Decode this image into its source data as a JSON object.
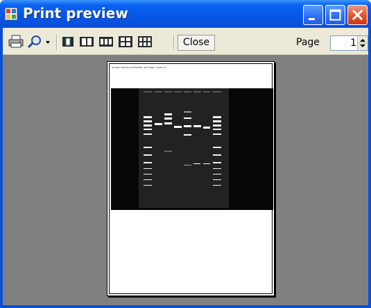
{
  "window": {
    "title": "Print preview",
    "title_color": "#ffffff",
    "frame_color": "#0a4fd6",
    "close_button_color": "#e1542c"
  },
  "toolbar": {
    "print_icon": "printer-icon",
    "zoom_icon": "magnifier-icon",
    "zoom_dropdown_icon": "chevron-down-icon",
    "layout_icons": [
      "one-page-icon",
      "two-pages-icon",
      "three-pages-icon",
      "four-pages-icon",
      "six-pages-icon"
    ],
    "close_label": "Close",
    "page_label": "Page",
    "page_value": "1"
  },
  "preview": {
    "background": "#808080",
    "page_header_text": "Sample: Tuesday 01/01/2008 · gel image · lanes 1-9"
  }
}
